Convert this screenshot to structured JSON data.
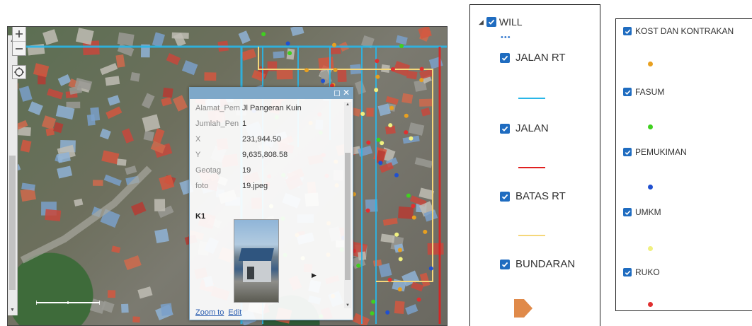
{
  "popup": {
    "attributes": [
      {
        "key": "Alamat_Pem",
        "value": "Jl Pangeran Kuin"
      },
      {
        "key": "Jumlah_Pen",
        "value": "1"
      },
      {
        "key": "X",
        "value": "231,944.50"
      },
      {
        "key": "Y",
        "value": "9,635,808.58"
      },
      {
        "key": "Geotag",
        "value": "19"
      },
      {
        "key": "foto",
        "value": "19.jpeg"
      }
    ],
    "section_title": "K1",
    "zoom_to": "Zoom to",
    "edit": "Edit"
  },
  "legend1": {
    "group_label": "WILL",
    "more": "•••",
    "layers": [
      {
        "label": "JALAN RT",
        "color": "#29b6e8"
      },
      {
        "label": "JALAN",
        "color": "#e02020"
      },
      {
        "label": "BATAS RT",
        "color": "#f5d77a"
      },
      {
        "label": "BUNDARAN",
        "color": "#e08a4a"
      }
    ]
  },
  "legend2": {
    "layers": [
      {
        "label": "KOST DAN KONTRAKAN",
        "color": "#e8a020"
      },
      {
        "label": "FASUM",
        "color": "#40d020"
      },
      {
        "label": "PEMUKIMAN",
        "color": "#2050d0"
      },
      {
        "label": "UMKM",
        "color": "#f0f080"
      },
      {
        "label": "RUKO",
        "color": "#e03030"
      }
    ]
  },
  "colors": {
    "checkbox": "#1f6cc0",
    "popup_header": "#7ea8c9",
    "link": "#2a5db0"
  }
}
